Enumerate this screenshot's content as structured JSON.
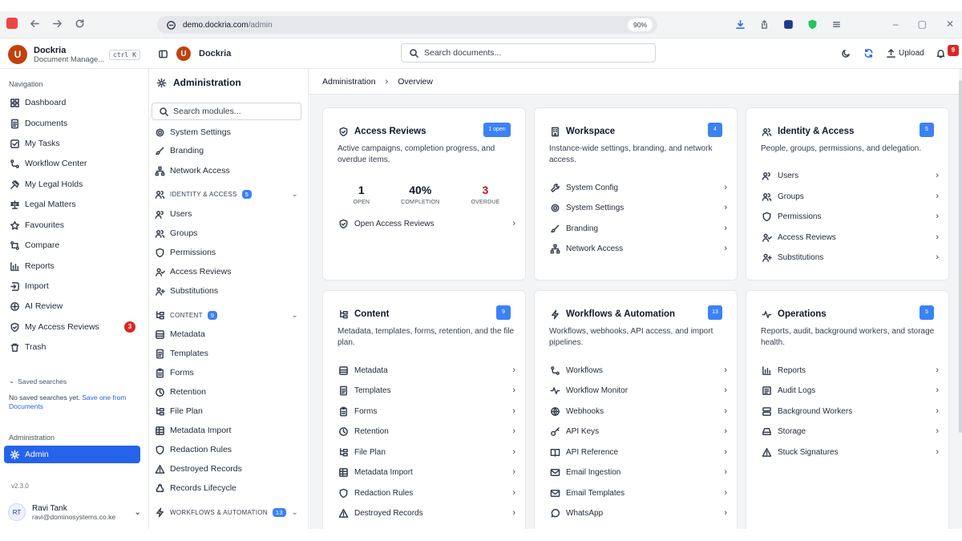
{
  "browser": {
    "url_host": "demo.dockria.com",
    "url_path": "/admin",
    "zoom": "90%",
    "extension_badge": "9+"
  },
  "brand": {
    "name": "Dockria",
    "subtitle": "Document Manage...",
    "shortcut": "ctrl K"
  },
  "header": {
    "app_name": "Dockria",
    "search_placeholder": "Search documents...",
    "upload_label": "Upload",
    "notification_count": "9"
  },
  "sidebar": {
    "nav_heading": "Navigation",
    "items": [
      {
        "label": "Dashboard",
        "icon": "grid-icon"
      },
      {
        "label": "Documents",
        "icon": "document-icon"
      },
      {
        "label": "My Tasks",
        "icon": "checkbox-icon"
      },
      {
        "label": "Workflow Center",
        "icon": "workflow-icon"
      },
      {
        "label": "My Legal Holds",
        "icon": "gavel-icon"
      },
      {
        "label": "Legal Matters",
        "icon": "scale-icon"
      },
      {
        "label": "Favourites",
        "icon": "star-icon"
      },
      {
        "label": "Compare",
        "icon": "compare-icon"
      },
      {
        "label": "Reports",
        "icon": "bar-chart-icon"
      },
      {
        "label": "Import",
        "icon": "import-icon"
      },
      {
        "label": "AI Review",
        "icon": "ai-icon"
      },
      {
        "label": "My Access Reviews",
        "icon": "shield-icon",
        "badge": "3"
      },
      {
        "label": "Trash",
        "icon": "trash-icon"
      }
    ],
    "saved_searches_label": "Saved searches",
    "saved_searches_empty": "No saved searches yet.",
    "saved_searches_link": "Save one from Documents",
    "admin_heading": "Administration",
    "admin_item": "Admin",
    "version": "v2.3.0",
    "user": {
      "initials": "RT",
      "name": "Ravi Tank",
      "email": "ravi@dominosystems.co.ke"
    }
  },
  "admin_panel": {
    "title": "Administration",
    "search_placeholder": "Search modules...",
    "items_top": [
      "System Settings",
      "Branding",
      "Network Access"
    ],
    "identity": {
      "label": "IDENTITY & ACCESS",
      "count": "5",
      "items": [
        "Users",
        "Groups",
        "Permissions",
        "Access Reviews",
        "Substitutions"
      ]
    },
    "content": {
      "label": "CONTENT",
      "count": "9",
      "items": [
        "Metadata",
        "Templates",
        "Forms",
        "Retention",
        "File Plan",
        "Metadata Import",
        "Redaction Rules",
        "Destroyed Records",
        "Records Lifecycle"
      ]
    },
    "workflows": {
      "label": "WORKFLOWS & AUTOMATION",
      "count": "13"
    }
  },
  "breadcrumb": {
    "root": "Administration",
    "current": "Overview"
  },
  "cards": {
    "access_reviews": {
      "title": "Access Reviews",
      "count": "1 open",
      "desc": "Active campaigns, completion progress, and overdue items.",
      "stats": [
        {
          "value": "1",
          "label": "OPEN"
        },
        {
          "value": "40%",
          "label": "COMPLETION"
        },
        {
          "value": "3",
          "label": "OVERDUE"
        }
      ],
      "link": "Open Access Reviews"
    },
    "workspace": {
      "title": "Workspace",
      "count": "4",
      "desc": "Instance-wide settings, branding, and network access.",
      "links": [
        "System Config",
        "System Settings",
        "Branding",
        "Network Access"
      ]
    },
    "identity": {
      "title": "Identity & Access",
      "count": "5",
      "desc": "People, groups, permissions, and delegation.",
      "links": [
        "Users",
        "Groups",
        "Permissions",
        "Access Reviews",
        "Substitutions"
      ]
    },
    "content": {
      "title": "Content",
      "count": "9",
      "desc": "Metadata, templates, forms, retention, and the file plan.",
      "links": [
        "Metadata",
        "Templates",
        "Forms",
        "Retention",
        "File Plan",
        "Metadata Import",
        "Redaction Rules",
        "Destroyed Records"
      ]
    },
    "workflows": {
      "title": "Workflows & Automation",
      "count": "13",
      "desc": "Workflows, webhooks, API access, and import pipelines.",
      "links": [
        "Workflows",
        "Workflow Monitor",
        "Webhooks",
        "API Keys",
        "API Reference",
        "Email Ingestion",
        "Email Templates",
        "WhatsApp"
      ]
    },
    "operations": {
      "title": "Operations",
      "count": "5",
      "desc": "Reports, audit, background workers, and storage health.",
      "links": [
        "Reports",
        "Audit Logs",
        "Background Workers",
        "Storage",
        "Stuck Signatures"
      ]
    }
  },
  "colors": {
    "accent": "#2563eb",
    "badge_blue": "#3b82f6",
    "danger": "#dc2626",
    "brand": "#c2410c"
  }
}
